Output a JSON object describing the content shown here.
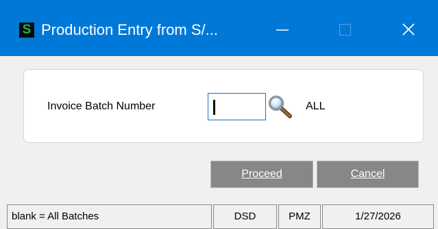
{
  "window": {
    "title": "Production Entry from S/...",
    "app_icon_letter": "S",
    "app_icon_color": "#22b24c",
    "titlebar_color": "#0078d7",
    "controls": {
      "minimize": "minimize-icon",
      "maximize": "maximize-icon",
      "close": "close-icon"
    }
  },
  "form": {
    "batch_label": "Invoice Batch Number",
    "batch_value": "",
    "lookup_icon": "magnifier-icon",
    "batch_display": "ALL"
  },
  "buttons": {
    "proceed": "Proceed",
    "cancel": "Cancel"
  },
  "status_bar": {
    "hint": "blank = All Batches",
    "company": "DSD",
    "user": "PMZ",
    "date": "1/27/2026"
  }
}
